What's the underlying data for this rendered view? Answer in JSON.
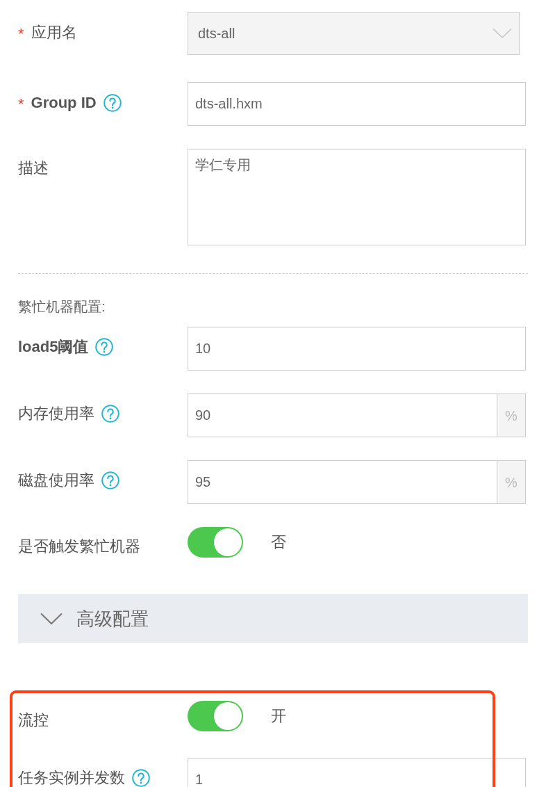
{
  "basic_fields": [
    {
      "kind": "select",
      "required_mark": "*",
      "label": "应用名",
      "value": "dts-all"
    },
    {
      "kind": "input",
      "required_mark": "*",
      "label": "Group ID",
      "bold": true,
      "help": true,
      "value": "dts-all.hxm"
    },
    {
      "kind": "textarea",
      "label": "描述",
      "value": "学仁专用"
    }
  ],
  "busy_section": {
    "title": "繁忙机器配置:",
    "fields": [
      {
        "kind": "input",
        "label": "load5阈值",
        "bold": true,
        "help": true,
        "value": "10"
      },
      {
        "kind": "input",
        "label": "内存使用率",
        "help": true,
        "value": "90",
        "suffix": "%"
      },
      {
        "kind": "input",
        "label": "磁盘使用率",
        "help": true,
        "value": "95",
        "suffix": "%"
      },
      {
        "kind": "switch",
        "label": "是否触发繁忙机器",
        "on": true,
        "status": "否"
      }
    ]
  },
  "advanced_panel": {
    "title": "高级配置",
    "expanded": true,
    "highlighted": true,
    "fields": [
      {
        "kind": "switch",
        "label": "流控",
        "on": true,
        "status": "开"
      },
      {
        "kind": "input",
        "label": "任务实例并发数",
        "help": true,
        "value": "1"
      }
    ]
  }
}
